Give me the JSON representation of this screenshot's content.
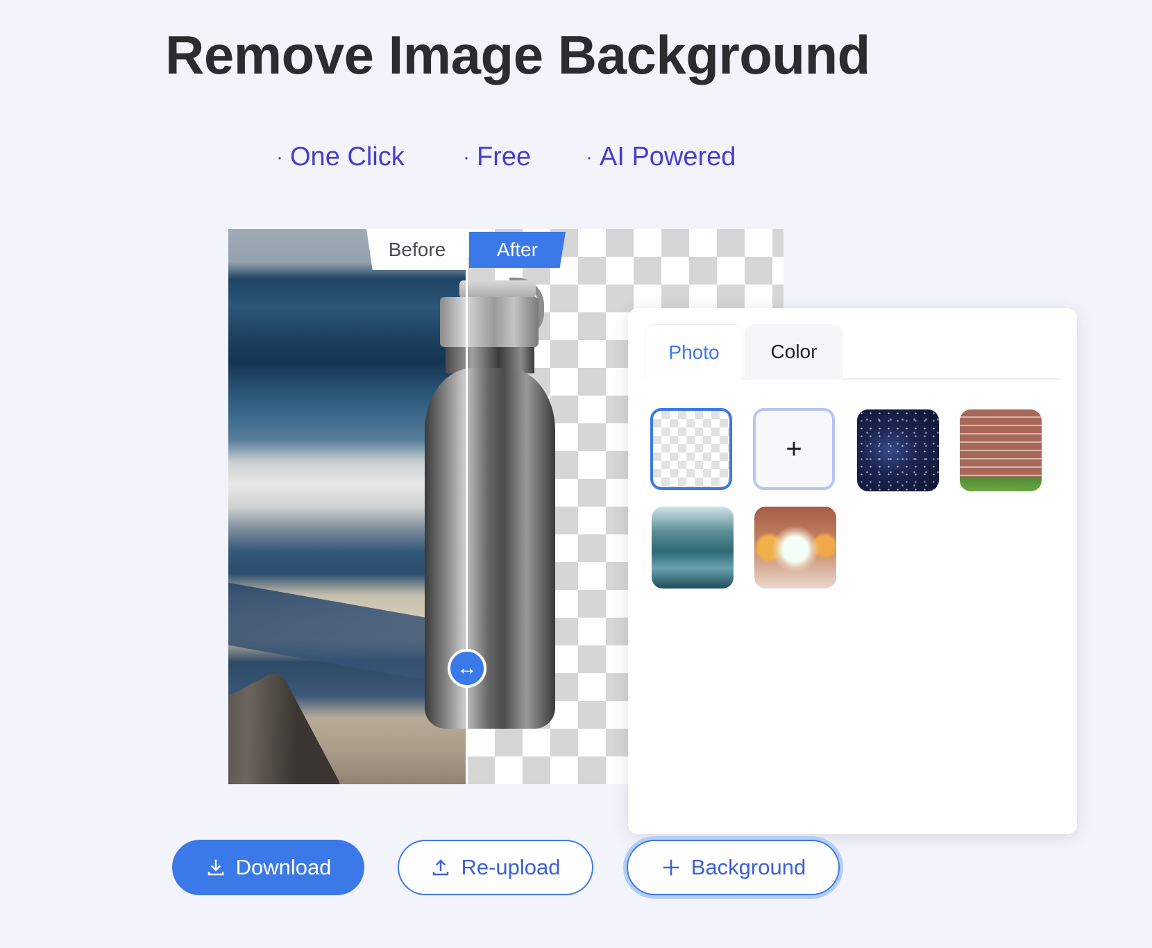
{
  "header": {
    "title": "Remove Image Background"
  },
  "features": [
    {
      "bullet": "·",
      "label": "One Click"
    },
    {
      "bullet": "·",
      "label": "Free"
    },
    {
      "bullet": "·",
      "label": "AI Powered"
    }
  ],
  "comparison": {
    "before_label": "Before",
    "after_label": "After",
    "slider_icon": "left-right-arrow-icon",
    "slider_glyph": "↔"
  },
  "background_panel": {
    "tabs": [
      {
        "label": "Photo",
        "active": true
      },
      {
        "label": "Color",
        "active": false
      }
    ],
    "thumbnails": [
      {
        "name": "transparent",
        "selected": true
      },
      {
        "name": "add-custom",
        "glyph": "+"
      },
      {
        "name": "starry-sky"
      },
      {
        "name": "brick-wall"
      },
      {
        "name": "forest-road"
      },
      {
        "name": "bokeh-lights"
      }
    ]
  },
  "actions": {
    "download_label": "Download",
    "reupload_label": "Re-upload",
    "background_label": "Background"
  },
  "colors": {
    "accent": "#3b79e8",
    "feature_text": "#4a3bd0",
    "title_text": "#2b2c30",
    "page_bg": "#f3f4fb"
  }
}
